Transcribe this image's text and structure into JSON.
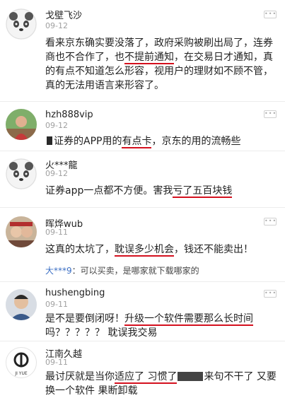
{
  "comments": [
    {
      "user": "戈壁飞沙",
      "date": "09-12",
      "text_a": "看来京东确实要没落了，政府采购被刷出局了，连券商也不合作了，也",
      "text_hl": "不提前通知",
      "text_b": "，在交易日才通知，真的有点不知道怎么形容，视用户的理财如不顾不管，真的无法用语言来形容了。",
      "avatar_icon": "panda-face-icon"
    },
    {
      "user": "hzh888vip",
      "date": "09-12",
      "text_a": "证券的APP用的",
      "text_hl": "有点卡",
      "text_b": "，京东的用的流畅些",
      "avatar_icon": "photo-avatar-icon"
    },
    {
      "user": "火***龍",
      "date": "09-12",
      "text_a": "证券app一点都不方便。害我",
      "text_hl": "亏了五百块钱",
      "text_b": "",
      "avatar_icon": "panda-face-icon"
    },
    {
      "user": "晖烨wub",
      "date": "09-11",
      "text_a": "这真的太坑了，",
      "text_hl": "耽误多少机会",
      "text_b": "，钱还不能卖出！",
      "reply_user": "大***9",
      "reply_text": "：可以买卖，是哪家就下载哪家的",
      "avatar_icon": "photo-avatar-icon"
    },
    {
      "user": "hushengbing",
      "date": "09-11",
      "text_a": "是不是要倒闭呀！",
      "text_hl": "升级一个软件需要那么长时间",
      "text_b": "吗？？？？？ 耽误我交易",
      "avatar_icon": "photo-avatar-icon"
    },
    {
      "user": "江南久越",
      "date": "09-11",
      "text_a": "最讨厌就是当你",
      "text_hl": "适应了 习惯了",
      "text_b": "来句不干了 又要换一个软件 果断卸载",
      "avatar_icon": "logo-avatar-icon",
      "avatar_logo_text": "JI YUE"
    }
  ],
  "colors": {
    "underline": "#d4101e",
    "reply_user": "#3b6fc4",
    "date": "#a0a0a0"
  }
}
